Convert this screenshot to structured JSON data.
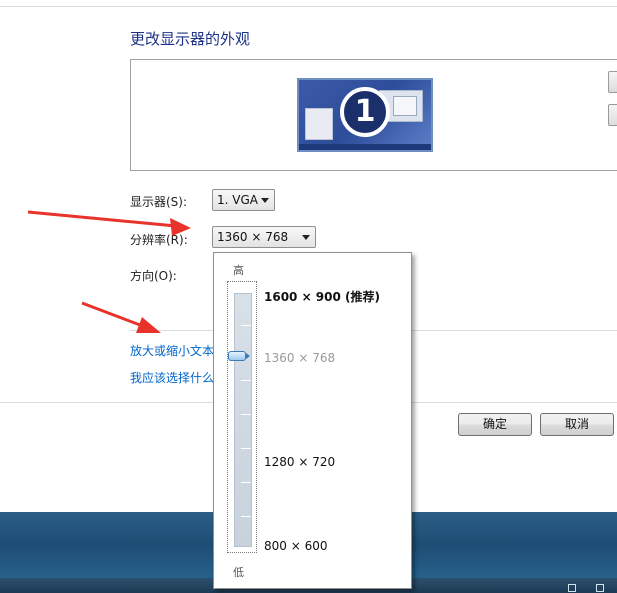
{
  "window": {
    "title": "更改显示器的外观"
  },
  "display": {
    "monitor_number": "1",
    "display_label": "显示器(S):",
    "display_value": "1. VGA",
    "resolution_label": "分辨率(R):",
    "resolution_value": "1360 × 768",
    "orientation_label": "方向(O):"
  },
  "links": {
    "text_size": "放大或缩小文本",
    "which_settings": "我应该选择什么"
  },
  "buttons": {
    "ok": "确定",
    "cancel": "取消"
  },
  "resolution_dropdown": {
    "high_label": "高",
    "low_label": "低",
    "options": [
      {
        "label": "1600 × 900 (推荐)",
        "recommended": true
      },
      {
        "label": "1360 × 768",
        "selected": true
      },
      {
        "label": "1280 × 720"
      },
      {
        "label": "800 × 600"
      }
    ]
  },
  "colors": {
    "title": "#1e3287",
    "link": "#0066cc",
    "annotation_arrow": "#e8332a",
    "taskbar": "#1e4d74"
  },
  "icons": {
    "dropdown_arrow": "chevron-down-icon",
    "slider_thumb": "slider-thumb-icon",
    "annotation": "red-arrow-icon"
  }
}
